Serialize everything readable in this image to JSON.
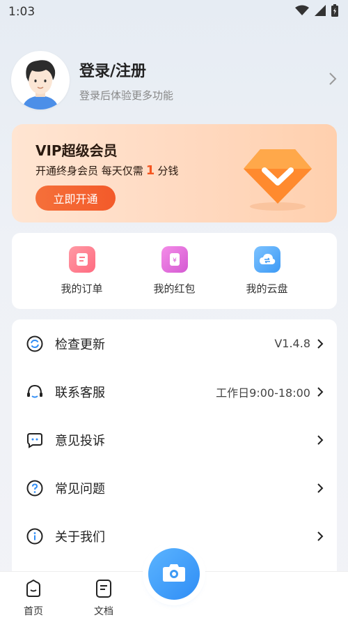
{
  "status_bar": {
    "time": "1:03"
  },
  "profile": {
    "title": "登录/注册",
    "subtitle": "登录后体验更多功能"
  },
  "vip": {
    "title": "VIP超级会员",
    "desc_prefix": "开通终身会员 每天仅需",
    "desc_number": "1",
    "desc_suffix": "分钱",
    "button": "立即开通"
  },
  "quick_actions": [
    {
      "label": "我的订单",
      "icon": "order-icon",
      "color": "#ff7b8a"
    },
    {
      "label": "我的红包",
      "icon": "red-packet-icon",
      "color": "#e66bd8"
    },
    {
      "label": "我的云盘",
      "icon": "cloud-disk-icon",
      "color": "#52a9f5"
    }
  ],
  "menu": [
    {
      "label": "检查更新",
      "value": "V1.4.8",
      "icon": "refresh-icon"
    },
    {
      "label": "联系客服",
      "value": "工作日9:00-18:00",
      "icon": "headset-icon"
    },
    {
      "label": "意见投诉",
      "value": "",
      "icon": "feedback-icon"
    },
    {
      "label": "常见问题",
      "value": "",
      "icon": "question-icon"
    },
    {
      "label": "关于我们",
      "value": "",
      "icon": "info-icon"
    }
  ],
  "bottom_nav": [
    {
      "label": "首页",
      "icon": "home-icon"
    },
    {
      "label": "文档",
      "icon": "document-icon"
    }
  ],
  "colors": {
    "accent": "#f35a2a",
    "brand_blue": "#2f8df5"
  }
}
